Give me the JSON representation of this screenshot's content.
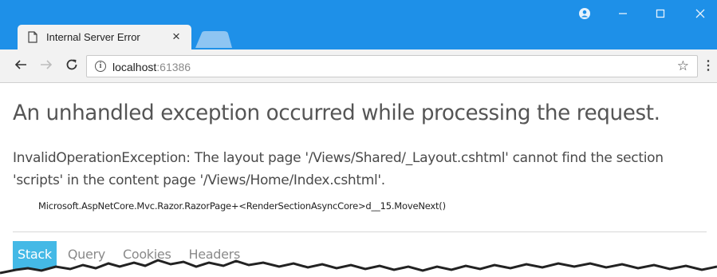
{
  "browser": {
    "tab_title": "Internal Server Error",
    "tab_close": "×",
    "url_host": "localhost",
    "url_port": ":61386",
    "accent_color": "#1e90e8"
  },
  "icons": {
    "doc": "document-icon",
    "profile": "profile-icon",
    "minimize": "minimize-icon",
    "maximize": "maximize-icon",
    "close": "close-icon",
    "back": "back-arrow-icon",
    "forward": "forward-arrow-icon",
    "reload": "reload-icon",
    "info": "info-icon",
    "star": "star-icon",
    "menu": "menu-icon"
  },
  "page": {
    "heading": "An unhandled exception occurred while processing the request.",
    "message": "InvalidOperationException: The layout page '/Views/Shared/_Layout.cshtml' cannot find the section 'scripts' in the content page '/Views/Home/Index.cshtml'.",
    "location": "Microsoft.AspNetCore.Mvc.Razor.RazorPage+<RenderSectionAsyncCore>d__15.MoveNext()",
    "tabs": [
      "Stack",
      "Query",
      "Cookies",
      "Headers"
    ],
    "active_tab": "Stack",
    "active_tab_color": "#44b9e6"
  }
}
